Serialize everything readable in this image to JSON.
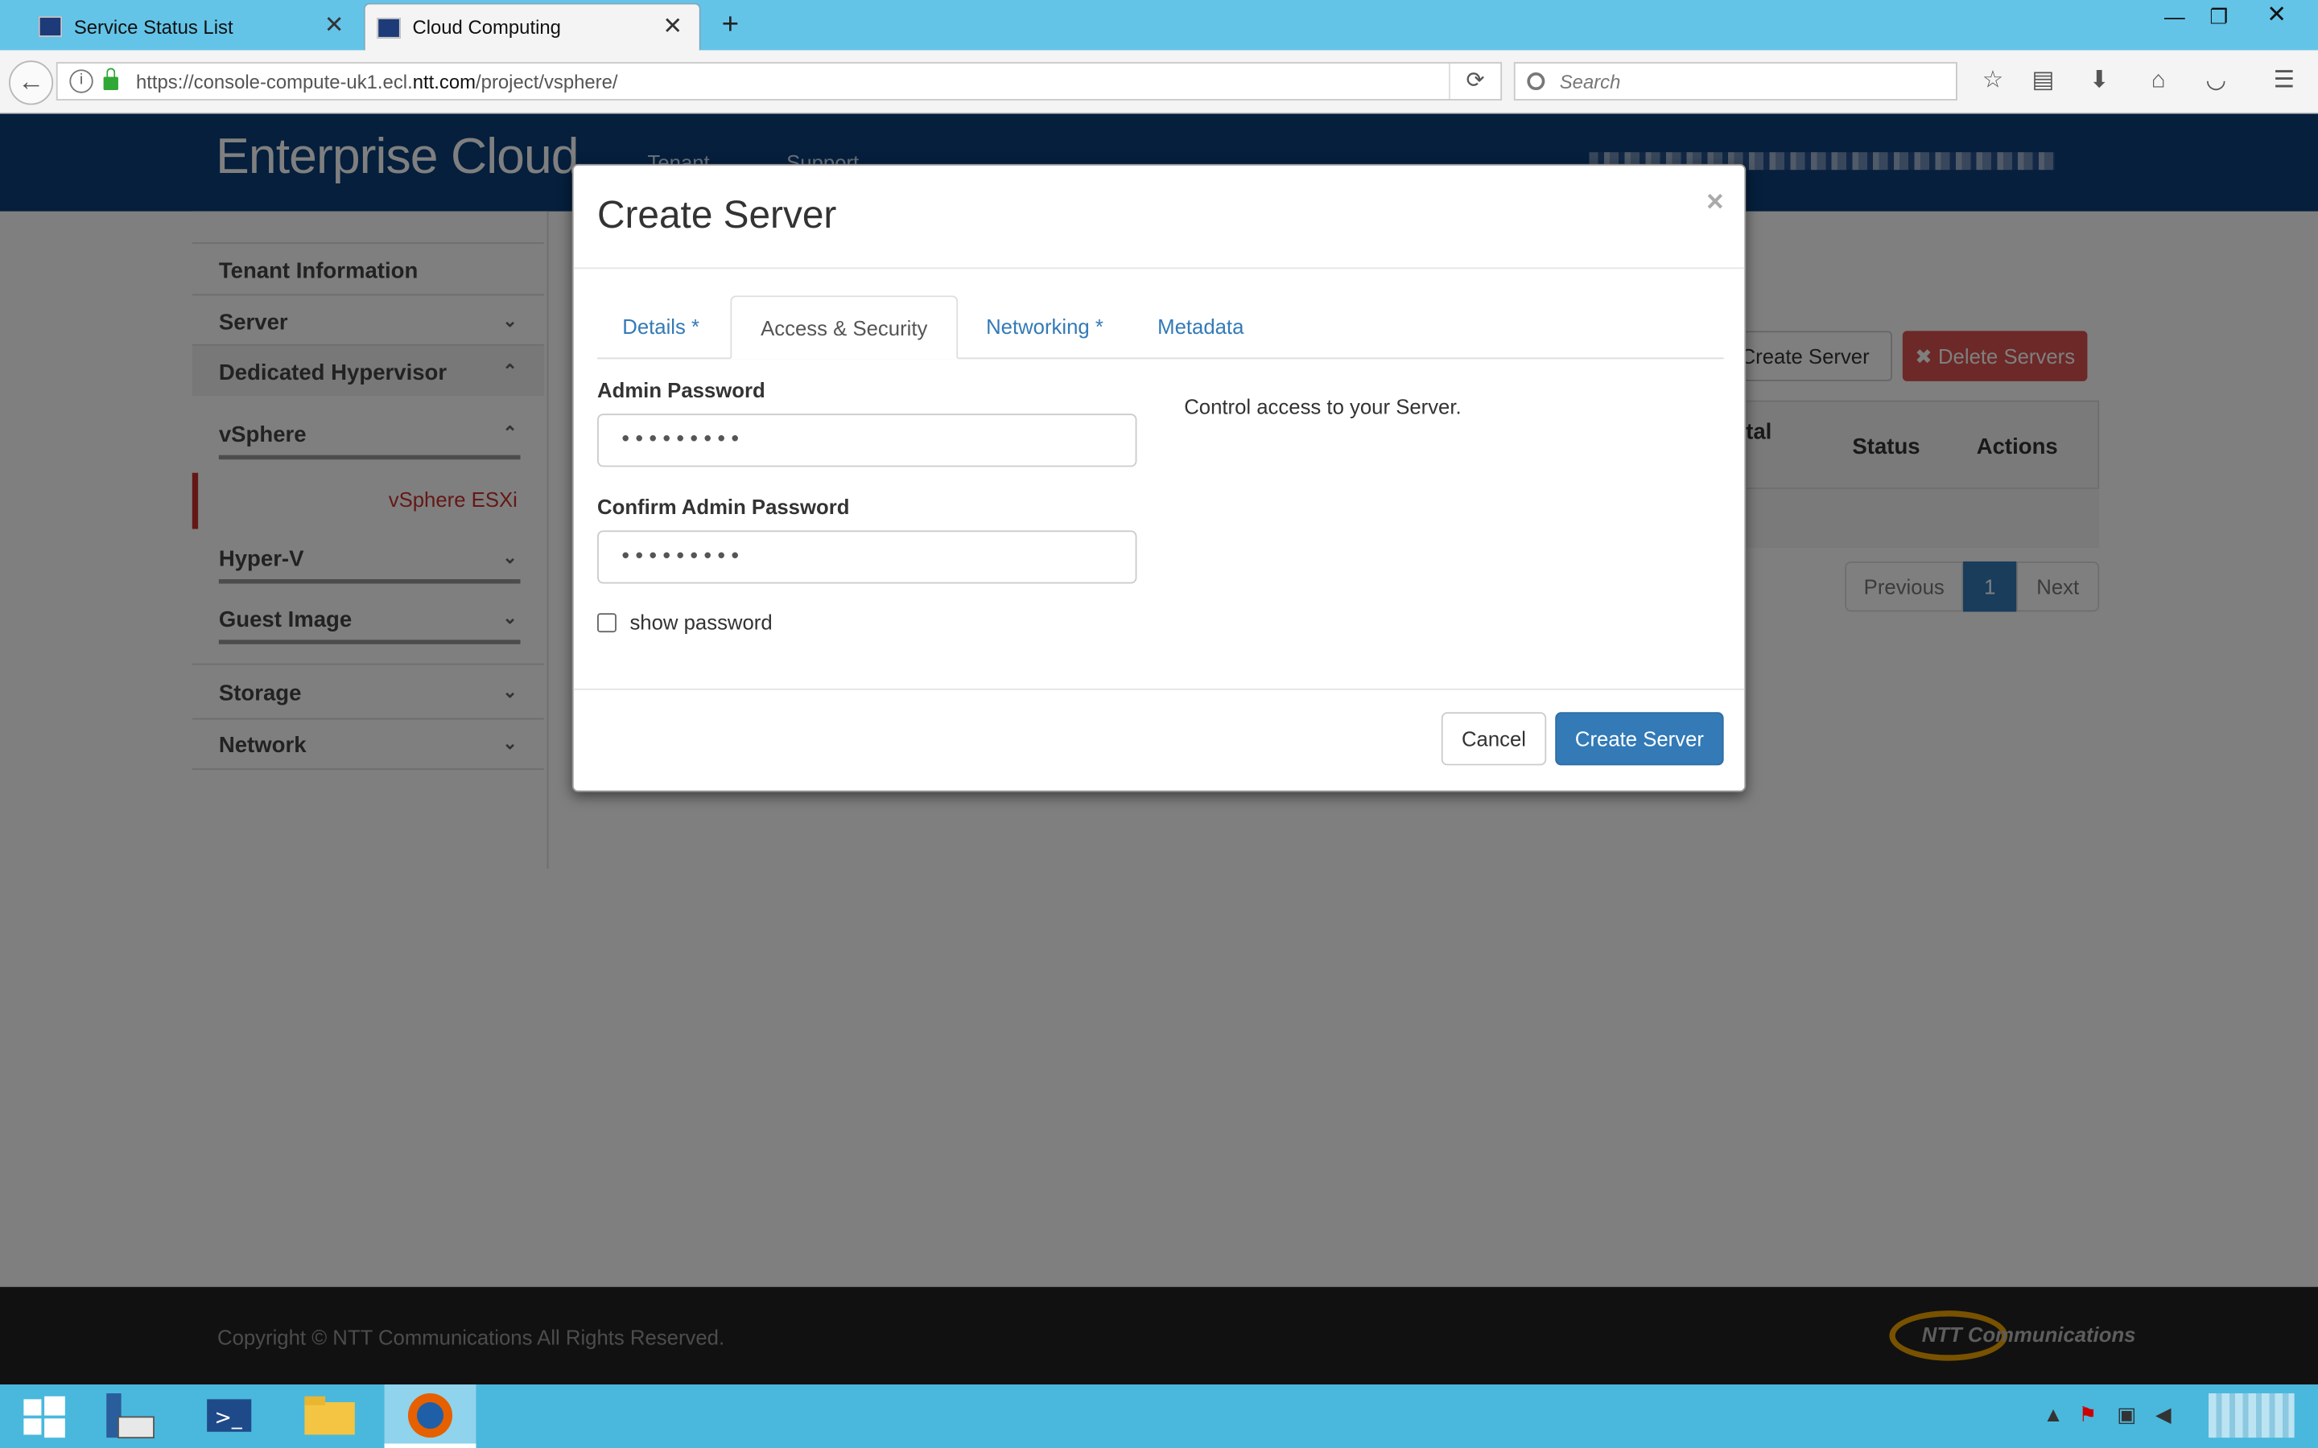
{
  "browser": {
    "tabs": [
      {
        "title": "Service Status List",
        "active": false
      },
      {
        "title": "Cloud Computing",
        "active": true
      }
    ],
    "url_prefix": "https://console-compute-uk1.ecl.",
    "url_domain": "ntt.com",
    "url_suffix": "/project/vsphere/",
    "search_placeholder": "Search",
    "window_controls": {
      "minimize": "—",
      "restore": "❐",
      "close": "✕"
    }
  },
  "app": {
    "brand": "Enterprise Cloud",
    "topnav": [
      "Tenant",
      "Support"
    ],
    "sidebar": {
      "items": [
        {
          "label": "Tenant Information",
          "chevron": ""
        },
        {
          "label": "Server",
          "chevron": "⌄"
        },
        {
          "label": "Dedicated Hypervisor",
          "chevron": "⌃"
        },
        {
          "label": "vSphere",
          "chevron": "⌃"
        },
        {
          "label": "Hyper-V",
          "chevron": "⌄"
        },
        {
          "label": "Guest Image",
          "chevron": "⌄"
        },
        {
          "label": "Storage",
          "chevron": "⌄"
        },
        {
          "label": "Network",
          "chevron": "⌄"
        }
      ],
      "active_sub": "vSphere ESXi"
    },
    "actions": {
      "create": "Create Server",
      "delete": "Delete Servers"
    },
    "table_headers": [
      "tal",
      "Status",
      "Actions"
    ],
    "pagination": {
      "prev": "Previous",
      "page": "1",
      "next": "Next"
    },
    "footer": {
      "copyright": "Copyright © NTT Communications All Rights Reserved.",
      "logo": "NTT Communications"
    }
  },
  "modal": {
    "title": "Create Server",
    "close": "×",
    "tabs": [
      "Details *",
      "Access & Security",
      "Networking *",
      "Metadata"
    ],
    "active_tab": "Access & Security",
    "fields": {
      "admin_password_label": "Admin Password",
      "admin_password_value": "•••••••••",
      "confirm_password_label": "Confirm Admin Password",
      "confirm_password_value": "•••••••••"
    },
    "show_password_label": "show password",
    "help_text": "Control access to your Server.",
    "buttons": {
      "cancel": "Cancel",
      "submit": "Create Server"
    }
  },
  "colors": {
    "header_blue": "#0a3e7a",
    "link_blue": "#337ab7",
    "danger_red": "#c9302c",
    "primary_button": "#337ab7",
    "taskbar": "#4ab8dd"
  }
}
